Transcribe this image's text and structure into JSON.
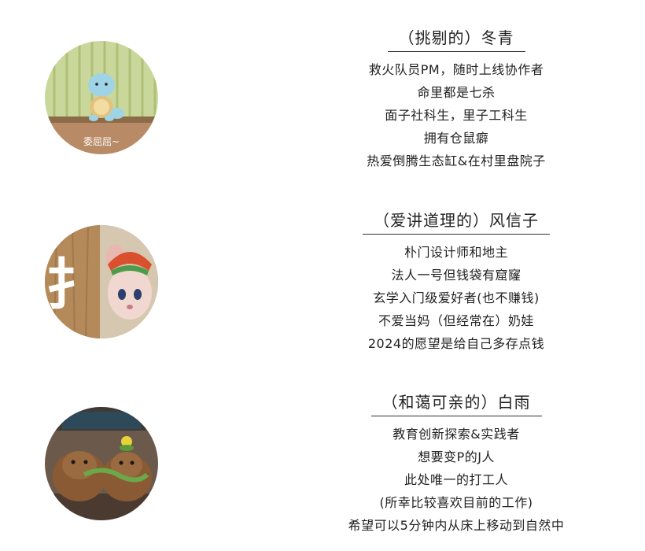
{
  "members": [
    {
      "name": "（挑剔的）冬青",
      "avatar_caption": "委屈屈~",
      "avatar_icon": "squirtle-avatar-icon",
      "lines": [
        "救火队员PM，随时上线协作者",
        "命里都是七杀",
        "面子社科生，里子工科生",
        "拥有仓鼠癖",
        "热爱倒腾生态缸&在村里盘院子"
      ]
    },
    {
      "name": "（爱讲道理的）风信子",
      "avatar_glyph": "扌",
      "avatar_icon": "plush-mouse-avatar-icon",
      "lines": [
        "朴门设计师和地主",
        "法人一号但钱袋有窟窿",
        "玄学入门级爱好者(也不赚钱)",
        "不爱当妈（但经常在）奶娃",
        "2024的愿望是给自己多存点钱"
      ]
    },
    {
      "name": "（和蔼可亲的）白雨",
      "avatar_icon": "capybara-plush-avatar-icon",
      "lines": [
        "教育创新探索&实践者",
        "想要变P的J人",
        "此处唯一的打工人",
        "(所幸比较喜欢目前的工作)",
        "希望可以5分钟内从床上移动到自然中"
      ]
    }
  ]
}
